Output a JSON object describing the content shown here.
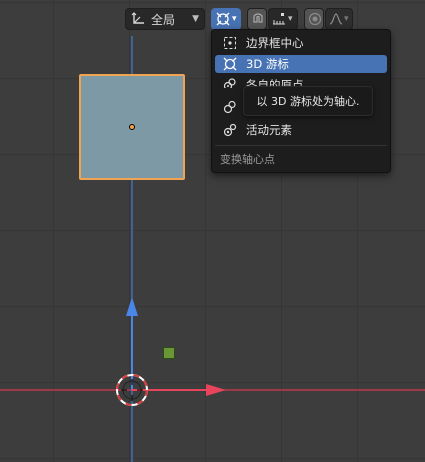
{
  "header": {
    "transform_orientation": "全局",
    "pivot_icon": "3d-cursor-icon",
    "snap_icon": "magnet-icon",
    "snap_increment_icon": "increment-icon",
    "proportional_icon": "proportional-edit-icon",
    "falloff_icon": "falloff-curve-icon"
  },
  "pivot_menu": {
    "items": [
      {
        "label": "边界框中心",
        "icon": "bounding-box-center-icon",
        "selected": false
      },
      {
        "label": "3D 游标",
        "icon": "3d-cursor-icon",
        "selected": true
      },
      {
        "label": "各自的原点",
        "icon": "individual-origins-icon",
        "selected": false
      },
      {
        "label": "",
        "icon": "median-point-icon",
        "selected": false
      },
      {
        "label": "活动元素",
        "icon": "active-element-icon",
        "selected": false
      }
    ],
    "footer": "变换轴心点"
  },
  "tooltip": "以 3D 游标处为轴心.",
  "colors": {
    "accent": "#4772b3",
    "selection_outline": "#f0a452",
    "x_axis": "#d93a4f",
    "z_axis": "#3c7fd6",
    "y_axis": "#4a86e8",
    "cube_fill": "#7d99a6",
    "light_object": "#6a9638"
  }
}
